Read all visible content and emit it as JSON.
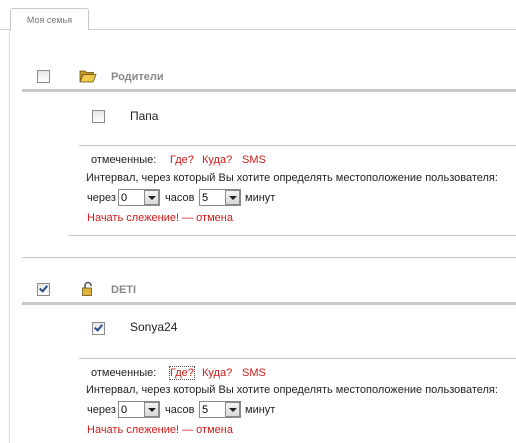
{
  "tab": {
    "label": "Моя семья"
  },
  "groups": [
    {
      "name": "Родители",
      "checked": false,
      "icon": "folder-open-icon",
      "members": [
        {
          "name": "Папа",
          "checked": false
        }
      ],
      "actions": {
        "marked_label": "отмеченные:",
        "where": "Где?",
        "to_where": "Куда?",
        "sms": "SMS",
        "interval_text": "Интервал, через который Вы хотите определять местоположение пользователя:",
        "through_label": "через",
        "hours_value": "0",
        "hours_label": "часов",
        "minutes_value": "5",
        "minutes_label": "минут",
        "start": "Начать слежение!",
        "dash": "—",
        "cancel": "отмена"
      }
    },
    {
      "name": "DETI",
      "checked": true,
      "icon": "padlock-icon",
      "members": [
        {
          "name": "Sonya24",
          "checked": true
        }
      ],
      "actions": {
        "marked_label": "отмеченные:",
        "where": "Где?",
        "to_where": "Куда?",
        "sms": "SMS",
        "interval_text": "Интервал, через который Вы хотите определять местоположение пользователя:",
        "through_label": "через",
        "hours_value": "0",
        "hours_label": "часов",
        "minutes_value": "5",
        "minutes_label": "минут",
        "start": "Начать слежение!",
        "dash": "—",
        "cancel": "отмена"
      }
    }
  ],
  "colors": {
    "accent_red": "#cc1a1a",
    "rule_gray": "#c8c8c8",
    "title_gray": "#888888"
  }
}
